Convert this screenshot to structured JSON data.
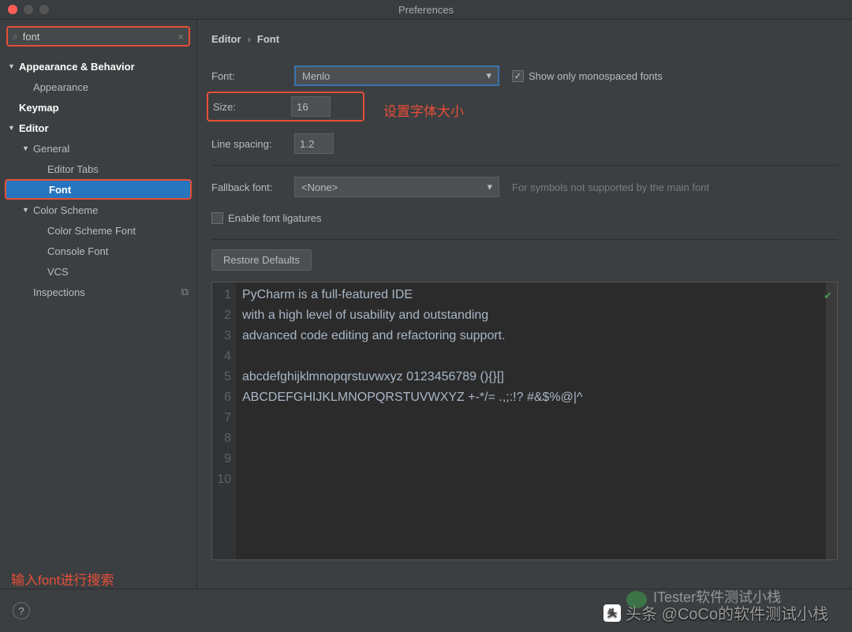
{
  "window": {
    "title": "Preferences"
  },
  "search": {
    "value": "font"
  },
  "sidebar": {
    "items": [
      {
        "label": "Appearance & Behavior",
        "arrow": "▼",
        "bold": true,
        "lvl": 0
      },
      {
        "label": "Appearance",
        "lvl": 1
      },
      {
        "label": "Keymap",
        "bold": true,
        "lvl": 0
      },
      {
        "label": "Editor",
        "arrow": "▼",
        "bold": true,
        "lvl": 0
      },
      {
        "label": "General",
        "arrow": "▼",
        "lvl": 1
      },
      {
        "label": "Editor Tabs",
        "lvl": 2
      },
      {
        "label": "Font",
        "lvl": 1,
        "selected": true,
        "boxed": true
      },
      {
        "label": "Color Scheme",
        "arrow": "▼",
        "lvl": 1
      },
      {
        "label": "Color Scheme Font",
        "lvl": 2
      },
      {
        "label": "Console Font",
        "lvl": 2
      },
      {
        "label": "VCS",
        "lvl": 2
      },
      {
        "label": "Inspections",
        "lvl": 1,
        "copy": true
      }
    ],
    "annotation": "输入font进行搜索"
  },
  "breadcrumb": {
    "a": "Editor",
    "sep": "›",
    "b": "Font"
  },
  "form": {
    "font_label": "Font:",
    "font_value": "Menlo",
    "monospace_label": "Show only monospaced fonts",
    "monospace_checked": "✓",
    "size_label": "Size:",
    "size_value": "16",
    "size_anno": "设置字体大小",
    "line_spacing_label": "Line spacing:",
    "line_spacing_value": "1.2",
    "fallback_label": "Fallback font:",
    "fallback_value": "<None>",
    "fallback_hint": "For symbols not supported by the main font",
    "ligatures_label": "Enable font ligatures",
    "restore": "Restore Defaults"
  },
  "preview": {
    "lines": [
      "PyCharm is a full-featured IDE",
      "with a high level of usability and outstanding",
      "advanced code editing and refactoring support.",
      "",
      "abcdefghijklmnopqrstuvwxyz 0123456789 (){}[]",
      "ABCDEFGHIJKLMNOPQRSTUVWXYZ +-*/= .,;:!? #&$%@|^",
      "",
      "",
      "",
      ""
    ]
  },
  "watermark": {
    "text1": "头条 @CoCo的软件测试小栈",
    "text2": "ITester软件测试小栈"
  }
}
